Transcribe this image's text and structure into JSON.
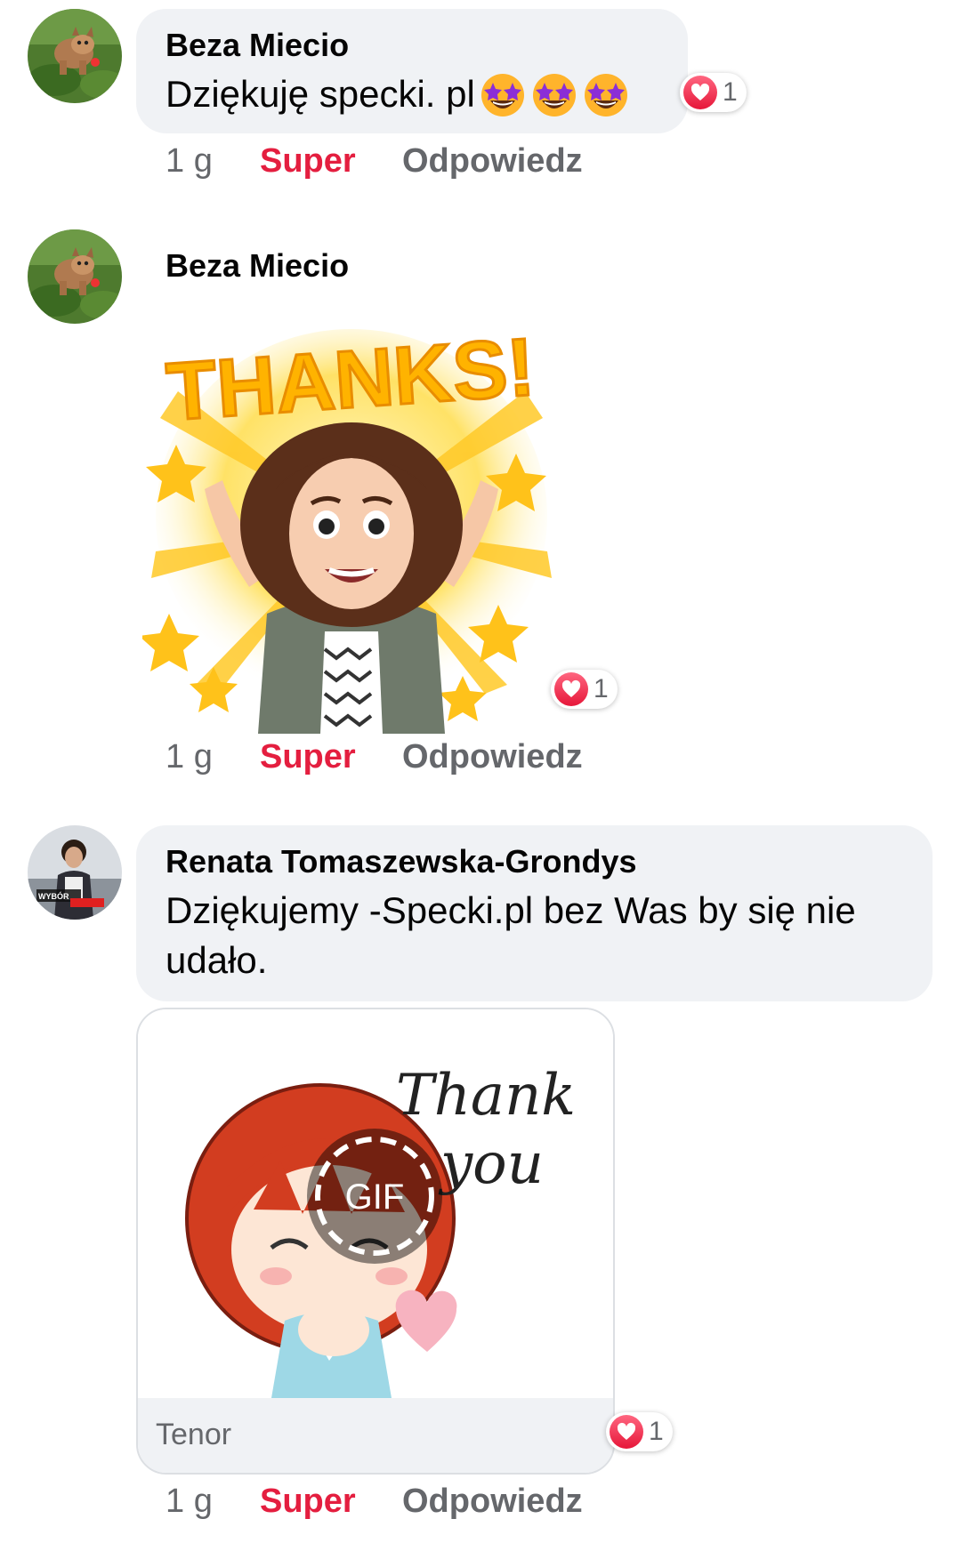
{
  "comments": [
    {
      "author": "Beza Miecio",
      "text": "Dziękuję specki. pl",
      "emojis": [
        "star-struck",
        "star-struck",
        "star-struck"
      ],
      "reaction": {
        "icon": "heart-icon",
        "count": "1"
      },
      "time": "1 g",
      "like_label": "Super",
      "reply_label": "Odpowiedz"
    },
    {
      "author": "Beza Miecio",
      "sticker": {
        "text": "THANKS!"
      },
      "reaction": {
        "icon": "heart-icon",
        "count": "1"
      },
      "time": "1 g",
      "like_label": "Super",
      "reply_label": "Odpowiedz"
    },
    {
      "author": "Renata Tomaszewska-Grondys",
      "text_line1": "Dziękujemy -Specki.pl bez Was by się nie",
      "text_line2": "udało.",
      "gif": {
        "text_line1": "Thank",
        "text_line2": "you",
        "badge": "GIF",
        "provider": "Tenor"
      },
      "reaction": {
        "icon": "heart-icon",
        "count": "1"
      },
      "time": "1 g",
      "like_label": "Super",
      "reply_label": "Odpowiedz"
    }
  ],
  "colors": {
    "bubble": "#f0f2f5",
    "super": "#e41e3f",
    "secondary_text": "#65676b",
    "heart": "#e61739"
  }
}
